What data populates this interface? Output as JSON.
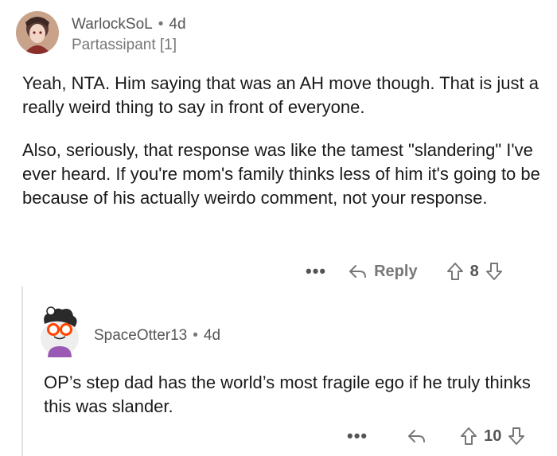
{
  "comment1": {
    "username": "WarlockSoL",
    "separator": "•",
    "age": "4d",
    "flair": "Partassipant [1]",
    "paragraphs": [
      "Yeah, NTA.  Him saying that was an AH move though. That is just a really weird thing to say in front of everyone.",
      "Also, seriously, that response was like the tamest \"slandering\" I've ever heard.  If you're mom's family thinks less of him it's going to be because of his actually weirdo comment, not your response."
    ],
    "more": "•••",
    "reply_label": "Reply",
    "score": "8"
  },
  "comment2": {
    "username": "SpaceOtter13",
    "separator": "•",
    "age": "4d",
    "text": "OP’s step dad has the world’s most fragile ego if he truly thinks this was slander.",
    "more": "•••",
    "score": "10"
  },
  "icons": {
    "more": "more-options-icon",
    "reply": "reply-arrow-icon",
    "upvote": "upvote-arrow-icon",
    "downvote": "downvote-arrow-icon"
  }
}
